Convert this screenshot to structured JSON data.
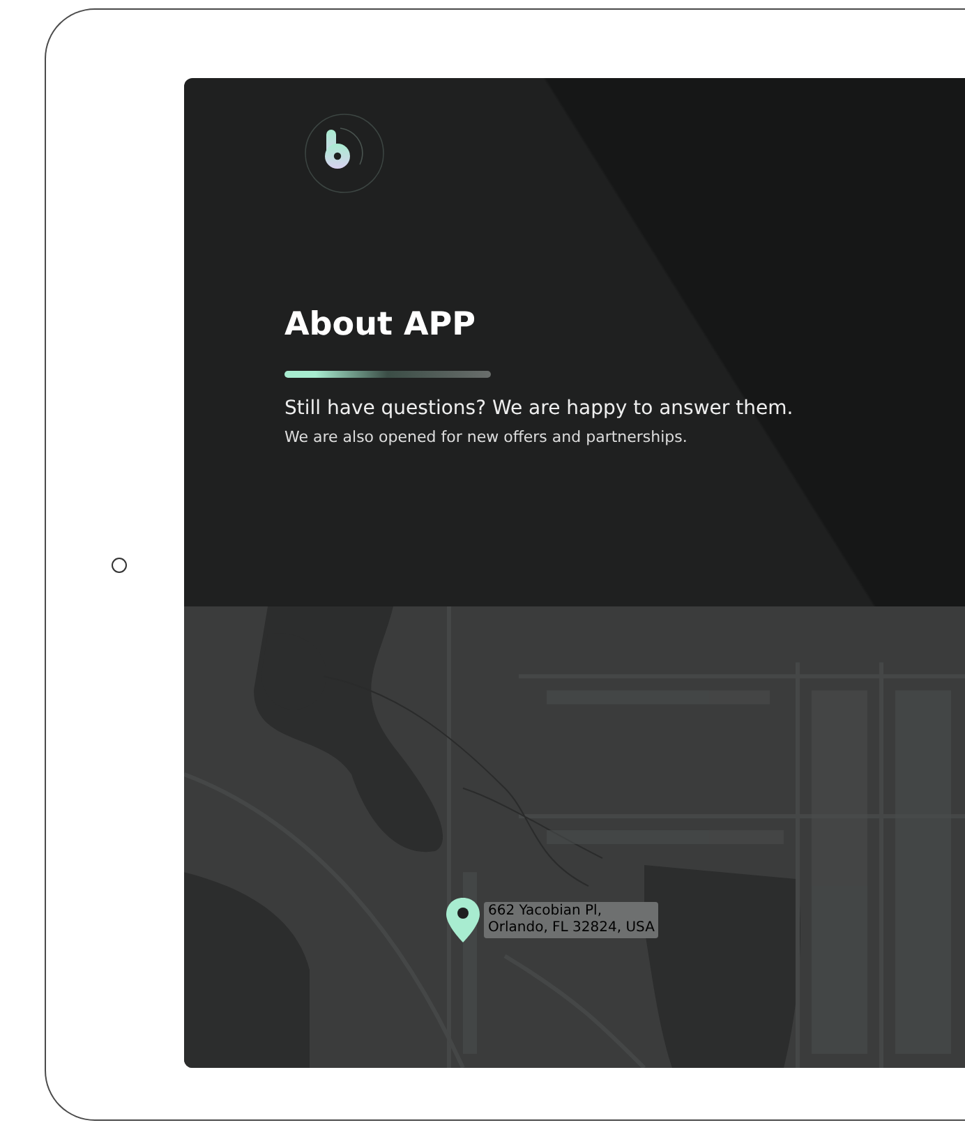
{
  "header": {
    "title": "About APP",
    "headline": "Still have questions? We are happy to answer them.",
    "subtext": "We are also opened for new offers and partnerships."
  },
  "map": {
    "address_lines": [
      "662 Yacobian Pl,",
      "Orlando, FL 32824, USA"
    ]
  }
}
